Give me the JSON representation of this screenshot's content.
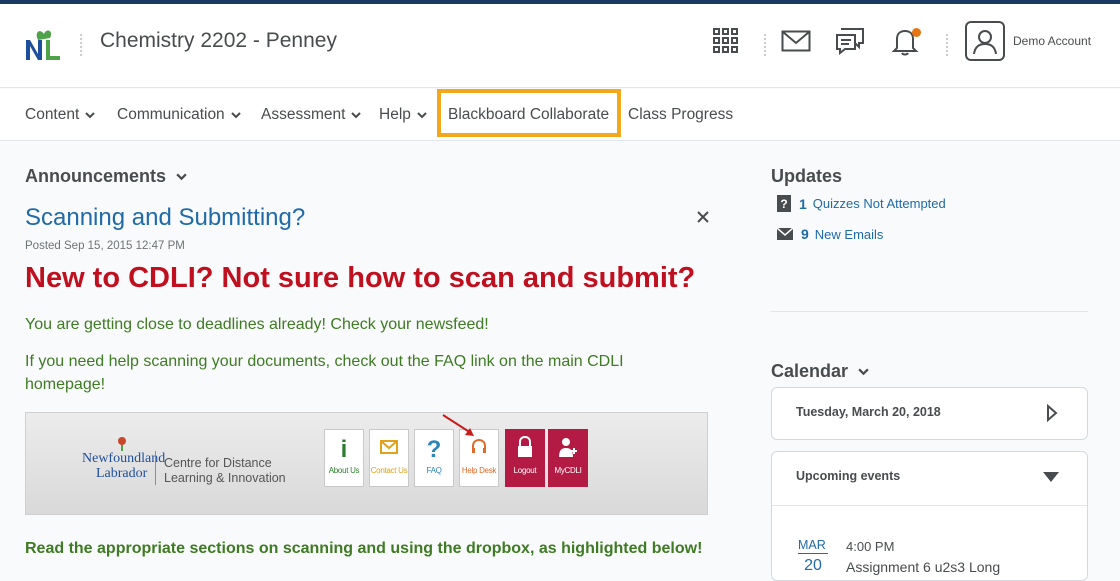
{
  "header": {
    "course_title": "Chemistry 2202 - Penney",
    "account_name": "Demo Account"
  },
  "nav": {
    "items": [
      {
        "label": "Content"
      },
      {
        "label": "Communication"
      },
      {
        "label": "Assessment"
      },
      {
        "label": "Help"
      },
      {
        "label": "Blackboard Collaborate"
      },
      {
        "label": "Class Progress"
      }
    ]
  },
  "announcements": {
    "header": "Announcements",
    "title": "Scanning and Submitting?",
    "posted": "Posted Sep 15, 2015 12:47 PM",
    "headline": "New to CDLI? Not sure how to scan and submit?",
    "para1": "You are getting close to deadlines already! Check your newsfeed!",
    "para2": "If you need help scanning your documents, check out the FAQ link on the main CDLI homepage!",
    "para3": "Read the appropriate sections on scanning and using the dropbox, as highlighted below!",
    "banner": {
      "nl_line1": "Newfoundland",
      "nl_line2": "Labrador",
      "cdli_line1": "Centre for Distance",
      "cdli_line2": "Learning & Innovation",
      "tiles": [
        {
          "glyph": "i",
          "label": "About Us"
        },
        {
          "glyph": "",
          "label": "Contact Us"
        },
        {
          "glyph": "?",
          "label": "FAQ"
        },
        {
          "glyph": "",
          "label": "Help Desk"
        },
        {
          "glyph": "",
          "label": "Logout"
        },
        {
          "glyph": "",
          "label": "MyCDLI"
        }
      ]
    }
  },
  "updates": {
    "header": "Updates",
    "items": [
      {
        "count": "1",
        "text": "Quizzes Not Attempted",
        "icon": "quiz-icon"
      },
      {
        "count": "9",
        "text": "New Emails",
        "icon": "envelope-icon"
      }
    ]
  },
  "calendar": {
    "header": "Calendar",
    "date": "Tuesday, March 20, 2018",
    "upcoming_label": "Upcoming events",
    "event": {
      "month": "MAR",
      "day": "20",
      "time": "4:00 PM",
      "title": "Assignment 6 u2s3 Long"
    }
  },
  "colors": {
    "link": "#1f6aa7",
    "headline": "#c00f1f",
    "green_text": "#3f7a24",
    "highlight": "#f2a81d",
    "notification": "#e87511"
  }
}
